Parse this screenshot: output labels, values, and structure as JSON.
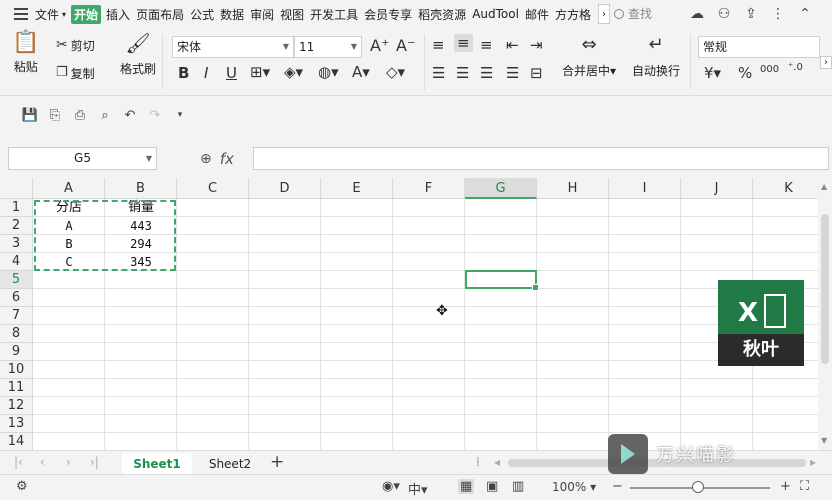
{
  "menu": {
    "items": [
      "文件",
      "开始",
      "插入",
      "页面布局",
      "公式",
      "数据",
      "审阅",
      "视图",
      "开发工具",
      "会员专享",
      "稻壳资源",
      "AudTool",
      "邮件",
      "方方格"
    ],
    "active_index": 1,
    "search_label": "查找"
  },
  "ribbon": {
    "paste": "粘贴",
    "cut": "剪切",
    "copy": "复制",
    "format_painter": "格式刷",
    "font_name": "宋体",
    "font_size": "11",
    "merge_center": "合并居中",
    "wrap_text": "自动换行",
    "number_format": "常规",
    "currency_symbol": "¥",
    "percent_symbol": "%",
    "thousands_symbol": "000"
  },
  "formula_bar": {
    "name_box": "G5",
    "fx": "fx",
    "content": ""
  },
  "grid": {
    "columns": [
      "A",
      "B",
      "C",
      "D",
      "E",
      "F",
      "G",
      "H",
      "I",
      "J",
      "K"
    ],
    "rows": [
      "1",
      "2",
      "3",
      "4",
      "5",
      "6",
      "7",
      "8",
      "9",
      "10",
      "11",
      "12",
      "13",
      "14"
    ],
    "selected_column": "G",
    "selected_row": "5",
    "cells": {
      "A1": "分店",
      "B1": "销量",
      "A2": "A",
      "B2": "443",
      "A3": "B",
      "B3": "294",
      "A4": "C",
      "B4": "345"
    }
  },
  "overlay": {
    "logo_text": "秋叶",
    "logo_letter": "X",
    "watermark": "万兴喵影"
  },
  "sheets": {
    "tabs": [
      "Sheet1",
      "Sheet2"
    ],
    "active": "Sheet1"
  },
  "status": {
    "zoom": "100%"
  },
  "colors": {
    "accent": "#3da86a",
    "logo_green": "#1f7a45"
  }
}
